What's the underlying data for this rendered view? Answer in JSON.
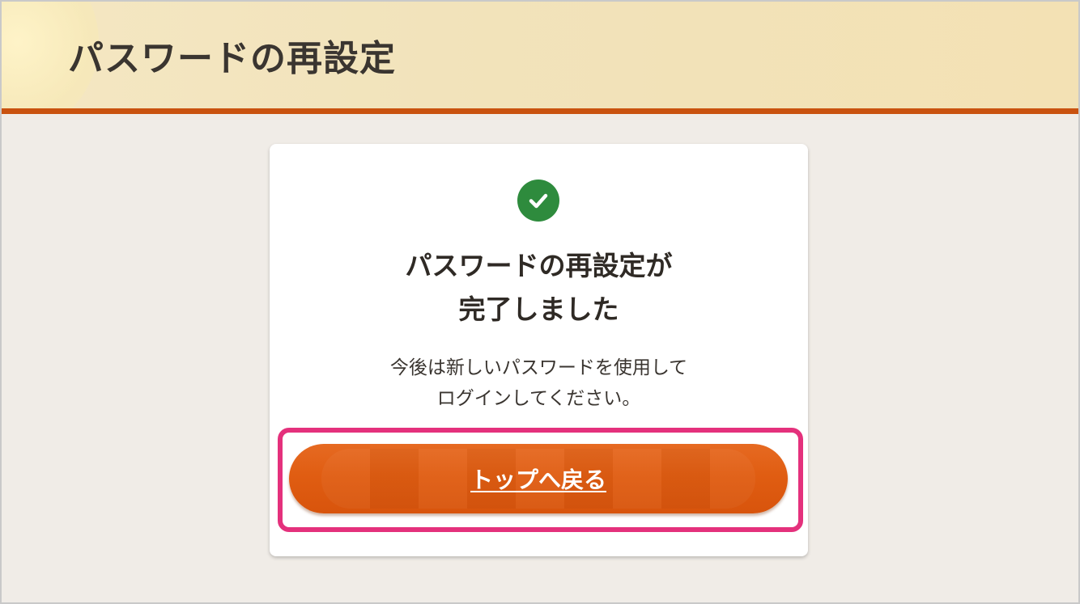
{
  "header": {
    "title": "パスワードの再設定"
  },
  "card": {
    "heading_line1": "パスワードの再設定が",
    "heading_line2": "完了しました",
    "message_line1": "今後は新しいパスワードを使用して",
    "message_line2": "ログインしてください。",
    "icon": "check-circle-icon"
  },
  "button": {
    "label": "トップへ戻る"
  },
  "colors": {
    "accent": "#e05d12",
    "header_line": "#c9520f",
    "success": "#2e8b3d",
    "highlight": "#e4317c"
  }
}
